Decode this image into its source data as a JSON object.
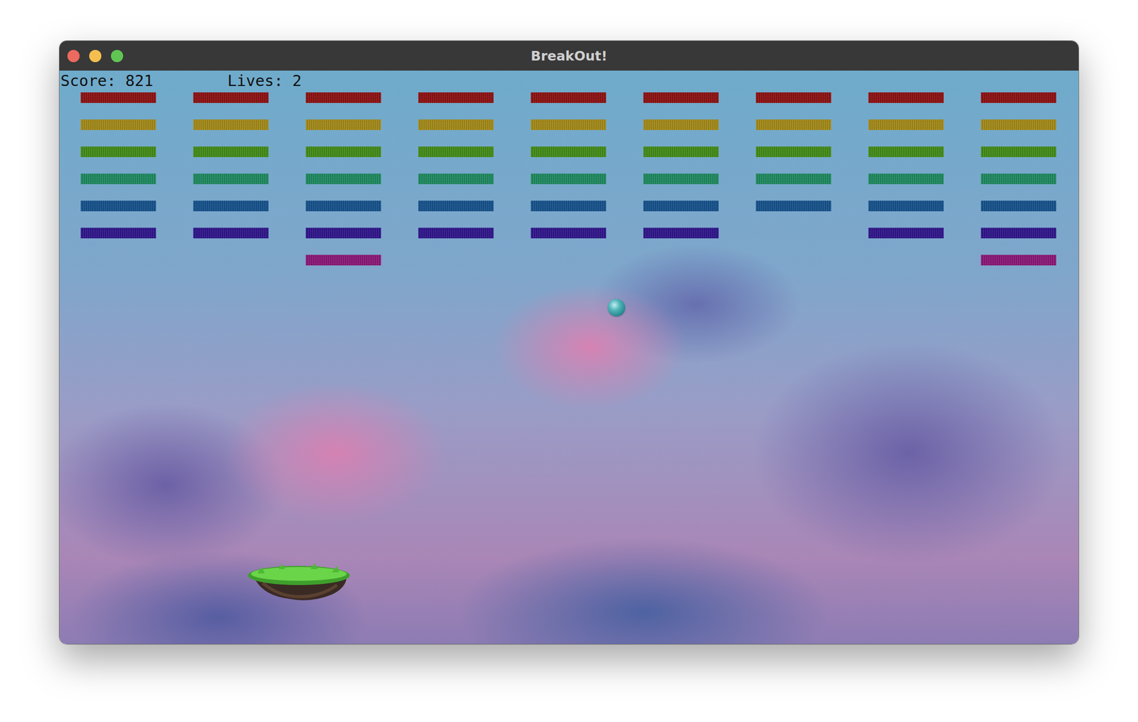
{
  "window": {
    "title": "BreakOut!"
  },
  "hud": {
    "score": "Score: 821",
    "lives": "Lives: 2"
  },
  "bricks": [
    {
      "color": "#8e0b0b",
      "present": [
        true,
        true,
        true,
        true,
        true,
        true,
        true,
        true,
        true
      ]
    },
    {
      "color": "#a58a12",
      "present": [
        true,
        true,
        true,
        true,
        true,
        true,
        true,
        true,
        true
      ]
    },
    {
      "color": "#3f8c12",
      "present": [
        true,
        true,
        true,
        true,
        true,
        true,
        true,
        true,
        true
      ]
    },
    {
      "color": "#188a5e",
      "present": [
        true,
        true,
        true,
        true,
        true,
        true,
        true,
        true,
        true
      ]
    },
    {
      "color": "#0f4f8c",
      "present": [
        true,
        true,
        true,
        true,
        true,
        true,
        true,
        true,
        true
      ]
    },
    {
      "color": "#2b0f8c",
      "present": [
        true,
        true,
        true,
        true,
        true,
        true,
        false,
        true,
        true
      ]
    },
    {
      "color": "#8c1176",
      "present": [
        false,
        false,
        true,
        false,
        false,
        false,
        false,
        false,
        true
      ]
    }
  ]
}
